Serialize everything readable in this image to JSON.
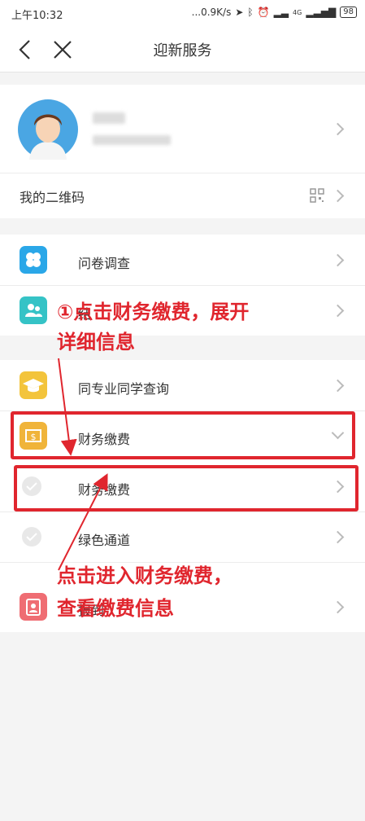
{
  "status_bar": {
    "time": "上午10:32",
    "net_speed": "...0.9K/s",
    "battery": "98",
    "signal": "4G"
  },
  "header": {
    "title": "迎新服务"
  },
  "profile": {
    "qr_label": "我的二维码"
  },
  "menu": {
    "survey": "问卷调查",
    "item2_partial": "结",
    "classmates": "同专业同学查询",
    "finance_group": "财务缴费",
    "finance_sub": "财务缴费",
    "green_channel": "绿色通道",
    "item_last_partial": "报到"
  },
  "annotations": {
    "step1_line1": "①点击财务缴费，展开",
    "step1_line2": "详细信息",
    "step2_line1": "点击进入财务缴费，",
    "step2_line2": "查看缴费信息"
  },
  "colors": {
    "annotation": "#e0262e",
    "survey_icon": "#2aa7e8",
    "group_icon": "#35c3c6",
    "classmates_icon": "#f3c43c",
    "finance_icon": "#f0b43a",
    "last_icon": "#ef6d73"
  }
}
